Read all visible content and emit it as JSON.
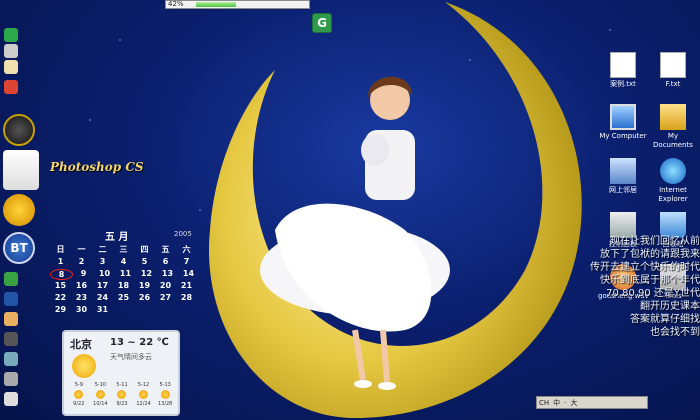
{
  "progress": {
    "percent_label": "42%",
    "value": 0.28
  },
  "top_icon": {
    "glyph": "G",
    "name": "g-app-icon"
  },
  "dock": {
    "photoshop_label": "Photoshop CS",
    "bt_label": "BT",
    "photoshop_subtext": "Photoshop"
  },
  "calendar": {
    "month": "五 月",
    "year": "2005",
    "weekdays": [
      "日",
      "一",
      "二",
      "三",
      "四",
      "五",
      "六"
    ],
    "rows": [
      [
        "1",
        "2",
        "3",
        "4",
        "5",
        "6",
        "7"
      ],
      [
        "8",
        "9",
        "10",
        "11",
        "12",
        "13",
        "14"
      ],
      [
        "15",
        "16",
        "17",
        "18",
        "19",
        "20",
        "21"
      ],
      [
        "22",
        "23",
        "24",
        "25",
        "26",
        "27",
        "28"
      ],
      [
        "29",
        "30",
        "31",
        "",
        "",
        "",
        ""
      ]
    ],
    "today": "8"
  },
  "weather": {
    "city": "北京",
    "temp": "13 ~ 22 ℃",
    "desc": "天气晴间多云",
    "days": [
      {
        "top": "5-9",
        "bottom": "9/22"
      },
      {
        "top": "5-10",
        "bottom": "10/14"
      },
      {
        "top": "5-11",
        "bottom": "9/23"
      },
      {
        "top": "5-12",
        "bottom": "12/24"
      },
      {
        "top": "5-13",
        "bottom": "13/28"
      }
    ]
  },
  "desktop_icons": [
    {
      "label": "案例.txt"
    },
    {
      "label": "F.txt"
    },
    {
      "label": "My Computer"
    },
    {
      "label": "My Documents"
    },
    {
      "label": "网上邻居"
    },
    {
      "label": "Internet Explorer"
    },
    {
      "label": "控制面板"
    },
    {
      "label": "回收站"
    },
    {
      "label": "gousheng.wav"
    },
    {
      "label": "Tools"
    }
  ],
  "poem": [
    "现在让我们回忆从前",
    "放下了包袱的请跟我来",
    "传开去建立个快乐的时代",
    "快乐到底属于那个年代",
    "70 80 90 还是Y世代",
    "翻开历史课本",
    "答案就算仔细找",
    "也会找不到"
  ],
  "ime": {
    "items": [
      "CH",
      "中",
      "·",
      "大"
    ]
  },
  "colors": {
    "moon": "#e6c842",
    "sky": "#0a1f6e",
    "accent": "#f2d66a"
  }
}
